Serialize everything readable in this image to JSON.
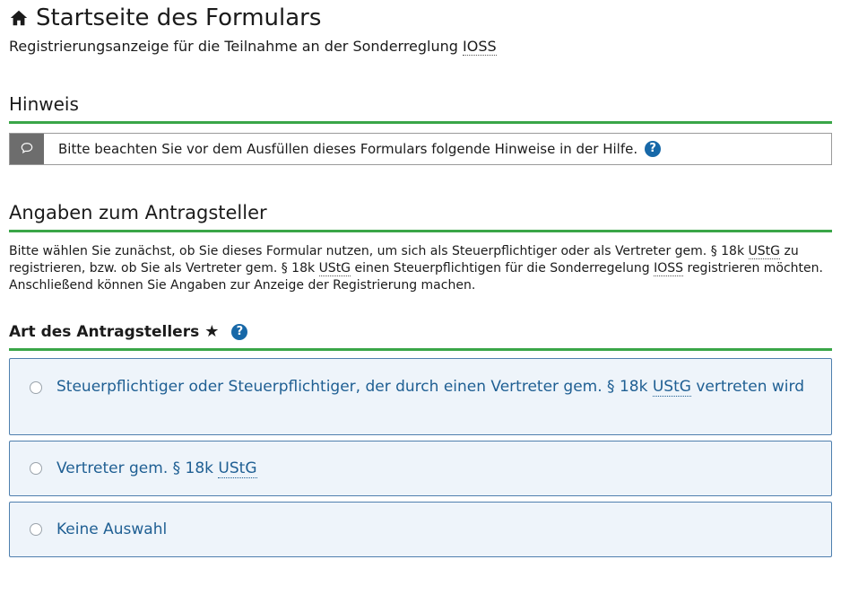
{
  "header": {
    "title": "Startseite des Formulars",
    "subtitle_prefix": "Registrierungsanzeige für die Teilnahme an der Sonderreglung ",
    "subtitle_abbr": "IOSS"
  },
  "hinweis": {
    "heading": "Hinweis",
    "text": "Bitte beachten Sie vor dem Ausfüllen dieses Formulars folgende Hinweise in der Hilfe.",
    "help_glyph": "?"
  },
  "antragsteller": {
    "heading": "Angaben zum Antragsteller",
    "intro_1": "Bitte wählen Sie zunächst, ob Sie dieses Formular nutzen, um sich als Steuerpflichtiger oder als Vertreter gem. § 18k ",
    "abbr_ustg": "UStG",
    "intro_2": " zu registrieren, bzw. ob Sie als Vertreter gem. § 18k ",
    "intro_3": " einen Steuerpflichtigen für die Sonderregelung ",
    "abbr_ioss": "IOSS",
    "intro_4": " registrieren möchten. Anschließend können Sie Angaben zur Anzeige der Registrierung machen."
  },
  "art": {
    "heading": "Art des Antragstellers",
    "required_mark": "★",
    "help_glyph": "?",
    "options": [
      {
        "label_prefix": "Steuerpflichtiger oder Steuerpflichtiger, der durch einen Vertreter gem. § 18k ",
        "label_abbr": "UStG",
        "label_suffix": " vertreten wird"
      },
      {
        "label_prefix": "Vertreter gem. § 18k ",
        "label_abbr": "UStG",
        "label_suffix": ""
      },
      {
        "label_prefix": "Keine Auswahl",
        "label_abbr": "",
        "label_suffix": ""
      }
    ]
  }
}
